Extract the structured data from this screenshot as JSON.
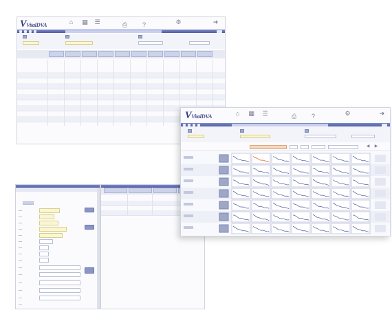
{
  "app": {
    "logo_text": "VitalDVA",
    "logo_v": "V"
  },
  "colors": {
    "accent": "#4f5da6",
    "header_bg": "#cdd3ea",
    "highlight": "#d9662b",
    "input_yellow": "#fbf6cf"
  },
  "icons": [
    "home-icon",
    "graph-icon",
    "list-icon",
    "print-icon",
    "help-icon",
    "logout-icon"
  ],
  "summary_window": {
    "row_labels": [
      "",
      "",
      "",
      "",
      "",
      "",
      "",
      "",
      "",
      ""
    ]
  },
  "trend_window": {
    "toolbar_note": "",
    "rows": 7,
    "columns": 7
  },
  "entry_form": {
    "field_count": 15
  },
  "result_list": {
    "columns": 4,
    "rows": 4
  }
}
